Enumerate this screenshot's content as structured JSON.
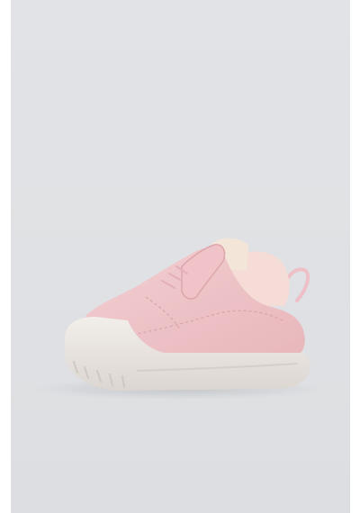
{
  "image": {
    "subject": "shoe-product-photo",
    "colors": {
      "background": "#dfe1e4",
      "upper": "#f0c8cc",
      "upper_shadow": "#dcaab0",
      "collar": "#f6dcd8",
      "sole": "#ece7e3",
      "sole_shadow": "#d6d0cc",
      "pull_loop": "#eec2ca"
    }
  }
}
